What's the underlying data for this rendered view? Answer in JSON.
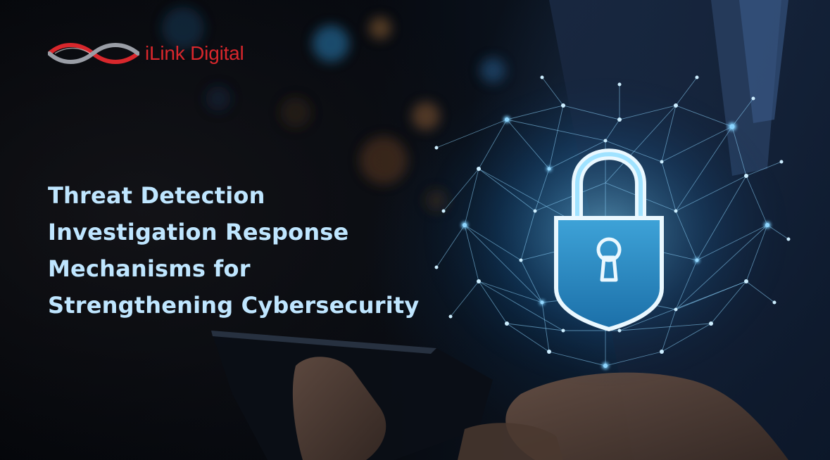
{
  "brand": {
    "name": "iLink Digital",
    "color": "#d8272c"
  },
  "headline": {
    "lines": [
      "Threat Detection",
      "Investigation Response",
      "Mechanisms for",
      "Strengthening Cybersecurity"
    ],
    "color": "#bfe6ff"
  },
  "illustration": {
    "icon": "padlock-icon",
    "description_elements": [
      "network-mesh",
      "tablet",
      "hands",
      "business-suit"
    ]
  }
}
